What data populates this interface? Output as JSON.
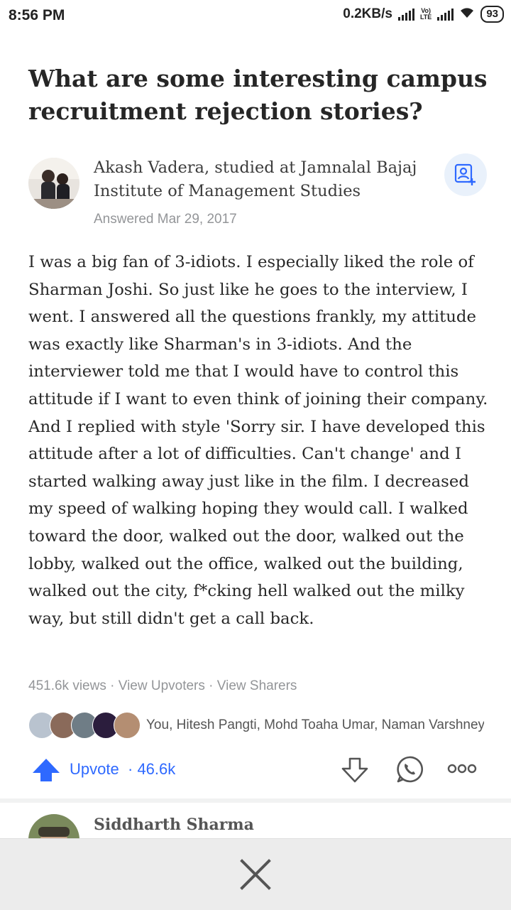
{
  "status_bar": {
    "time": "8:56 PM",
    "net_speed": "0.2KB/s",
    "volte_label": "Vo)",
    "lte_label": "LTE",
    "battery": "93"
  },
  "question": {
    "title": "What are some interesting campus recruitment rejection stories?"
  },
  "answer": {
    "author_credential": "Akash Vadera, studied at Jamnalal Bajaj Institute of Management Studies",
    "answered_date": "Answered Mar 29, 2017",
    "body": "I was a big fan of 3-idiots. I especially liked the role of Sharman Joshi. So just like he goes to the interview, I went. I answered all the questions frankly, my attitude was exactly like Sharman's in 3-idiots. And the interviewer told me that I would have to control this attitude if I want to even think of joining their company. And I replied with style 'Sorry sir. I have developed this attitude after a lot of difficulties. Can't change' and I started walking away just like in the film. I decreased my speed of walking hoping they would call. I walked toward the door, walked out the door, walked out the lobby, walked out the office, walked out the building, walked out the city, f*cking hell walked out the milky way, but still didn't get a call back.",
    "views": "451.6k views",
    "separator": " · ",
    "view_upvoters": "View Upvoters",
    "view_sharers": "View Sharers",
    "upvoters_names": "You, Hitesh Pangti, Mohd Toaha Umar, Naman Varshney",
    "upvote_label": "Upvote",
    "upvote_count": "· 46.6k"
  },
  "next_answer": {
    "author_name": "Siddharth Sharma"
  },
  "icons": {
    "follow": "person-add-icon",
    "upvote": "arrow-up-icon",
    "downvote": "arrow-down-icon",
    "share": "whatsapp-icon",
    "more": "more-dots-icon",
    "close": "close-icon"
  },
  "colors": {
    "accent": "#2e69ff",
    "meta_text": "#939598",
    "sheet_bg": "#ececec"
  }
}
